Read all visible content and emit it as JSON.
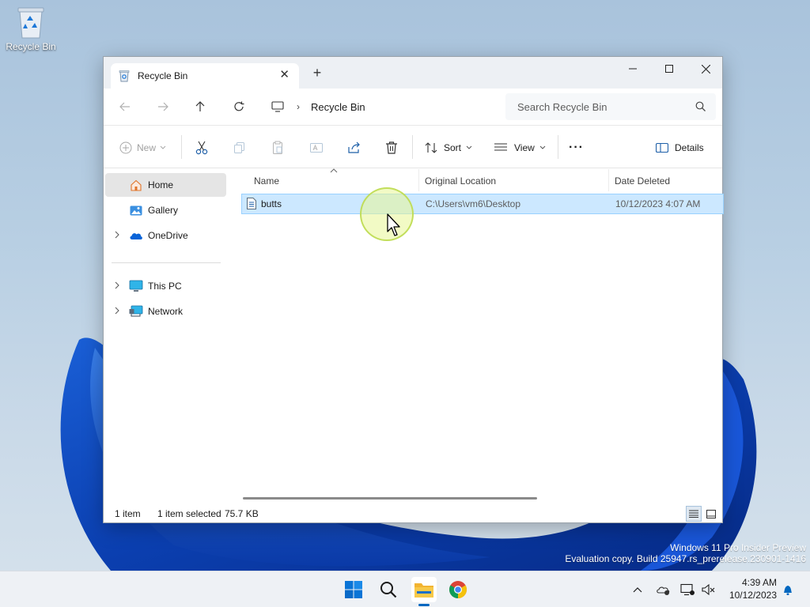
{
  "desktop": {
    "recycle_bin_label": "Recycle Bin",
    "watermark_line1": "Windows 11 Pro Insider Preview",
    "watermark_line2": "Evaluation copy. Build 25947.rs_prerelease.230901-1416"
  },
  "window": {
    "tab_title": "Recycle Bin",
    "tab_close_glyph": "✕",
    "new_tab_glyph": "+",
    "breadcrumb": "Recycle Bin",
    "breadcrumb_sep": "›",
    "search_placeholder": "Search Recycle Bin"
  },
  "toolbar": {
    "new_label": "New",
    "sort_label": "Sort",
    "view_label": "View",
    "more_label": "···",
    "details_label": "Details"
  },
  "sidebar": {
    "items": [
      {
        "label": "Home",
        "icon": "home-icon",
        "selected": true
      },
      {
        "label": "Gallery",
        "icon": "gallery-icon"
      },
      {
        "label": "OneDrive",
        "icon": "onedrive-icon",
        "expandable": true
      },
      {
        "label": "This PC",
        "icon": "this-pc-icon",
        "expandable": true
      },
      {
        "label": "Network",
        "icon": "network-icon",
        "expandable": true
      }
    ]
  },
  "columns": {
    "name": "Name",
    "original_location": "Original Location",
    "date_deleted": "Date Deleted"
  },
  "rows": [
    {
      "name": "butts",
      "original_location": "C:\\Users\\vm6\\Desktop",
      "date_deleted": "10/12/2023 4:07 AM",
      "selected": true
    }
  ],
  "status": {
    "item_count": "1 item",
    "selection": "1 item selected",
    "size": "75.7 KB"
  },
  "taskbar": {
    "time": "4:39 AM",
    "date": "10/12/2023",
    "apps": [
      "start-icon",
      "search-icon",
      "file-explorer-icon",
      "chrome-icon"
    ]
  },
  "colors": {
    "accent": "#0067c0",
    "selection_fill": "#cce8ff",
    "selection_border": "#99d1ff"
  }
}
